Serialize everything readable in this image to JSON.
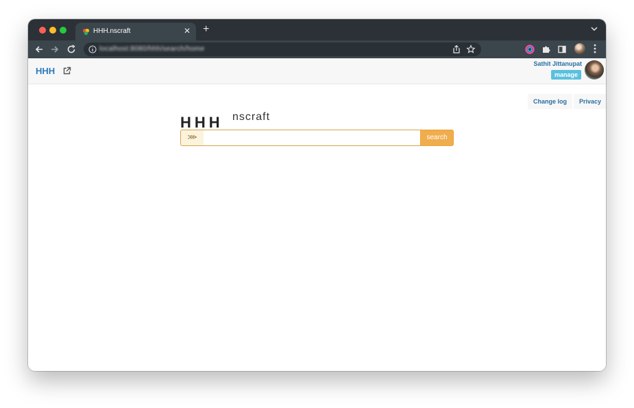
{
  "browser": {
    "tab": {
      "title": "HHH.nscraft"
    },
    "address": {
      "url": "localhost:8080/hhh/search/home"
    },
    "icons": [
      "back-icon",
      "forward-icon",
      "reload-icon",
      "info-icon",
      "share-icon",
      "star-icon",
      "color-extension-icon",
      "puzzle-icon",
      "sidebar-icon",
      "profile-avatar",
      "menu-icon"
    ]
  },
  "header": {
    "brand": "HHH",
    "user_name": "Sathit Jittanupat",
    "manage_label": "manage"
  },
  "links": {
    "changelog": "Change log",
    "privacy": "Privacy"
  },
  "logo": {
    "main": "HHH",
    "sub": "nscraft"
  },
  "search": {
    "prefix": "⋙",
    "value": "",
    "placeholder": "",
    "button": "search"
  },
  "colors": {
    "brand": "#2b7bb9",
    "search_button": "#f0ad4e",
    "manage_button": "#5bc0de",
    "titlebar": "#2b3136"
  }
}
